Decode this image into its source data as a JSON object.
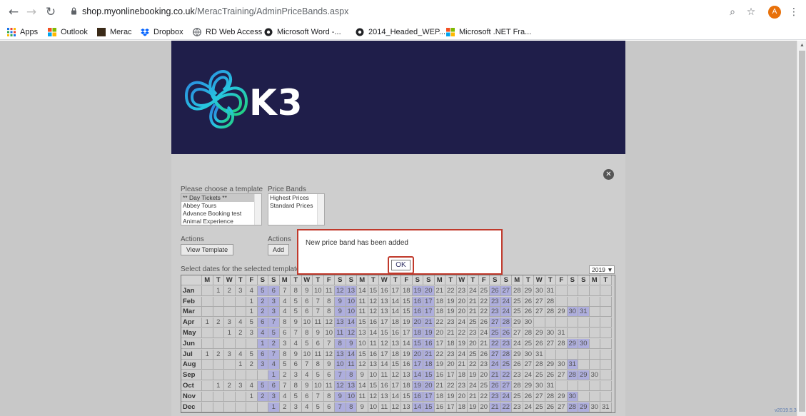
{
  "browser": {
    "url_host": "shop.myonlinebooking.co.uk",
    "url_path": "/MeracTraining/AdminPriceBands.aspx",
    "avatar_letter": "A",
    "bookmarks": [
      "Apps",
      "Outlook",
      "Merac",
      "Dropbox",
      "RD Web Access",
      "Microsoft Word -...",
      "2014_Headed_WEP...",
      "Microsoft .NET Fra..."
    ]
  },
  "brand": {
    "logo_text": "K3",
    "banner_color": "#1f1e4a"
  },
  "template_section": {
    "label": "Please choose a template",
    "options": [
      "** Day Tickets **",
      "Abbey Tours",
      "Advance Booking test",
      "Animal Experience"
    ],
    "selected_index": 0
  },
  "price_band_section": {
    "label": "Price Bands",
    "options": [
      "Highest Prices",
      "Standard Prices"
    ]
  },
  "actions_left": {
    "label": "Actions",
    "button": "View Template"
  },
  "actions_right": {
    "label": "Actions",
    "button": "Add"
  },
  "calendar": {
    "label": "Select dates for the selected template",
    "year": "2019 ▼",
    "weekday_headers": [
      "M",
      "T",
      "W",
      "T",
      "F",
      "S",
      "S",
      "M",
      "T",
      "W",
      "T",
      "F",
      "S",
      "S",
      "M",
      "T",
      "W",
      "T",
      "F",
      "S",
      "S",
      "M",
      "T",
      "W",
      "T",
      "F",
      "S",
      "S",
      "M",
      "T",
      "W",
      "T",
      "F",
      "S",
      "S",
      "M",
      "T"
    ],
    "months": [
      {
        "name": "Jan",
        "offset": 1,
        "days": 31
      },
      {
        "name": "Feb",
        "offset": 4,
        "days": 28
      },
      {
        "name": "Mar",
        "offset": 4,
        "days": 31
      },
      {
        "name": "Apr",
        "offset": 0,
        "days": 30
      },
      {
        "name": "May",
        "offset": 2,
        "days": 31
      },
      {
        "name": "Jun",
        "offset": 5,
        "days": 30
      },
      {
        "name": "Jul",
        "offset": 0,
        "days": 31
      },
      {
        "name": "Aug",
        "offset": 3,
        "days": 31
      },
      {
        "name": "Sep",
        "offset": 6,
        "days": 30
      },
      {
        "name": "Oct",
        "offset": 1,
        "days": 31
      },
      {
        "name": "Nov",
        "offset": 4,
        "days": 30
      },
      {
        "name": "Dec",
        "offset": 6,
        "days": 31
      }
    ]
  },
  "dialog": {
    "message": "New price band has been added",
    "ok_label": "OK"
  },
  "footer": {
    "version": "v2019.5.3"
  },
  "colors": {
    "weekend_highlight": "#aeaedd",
    "dialog_border": "#c0392b"
  }
}
